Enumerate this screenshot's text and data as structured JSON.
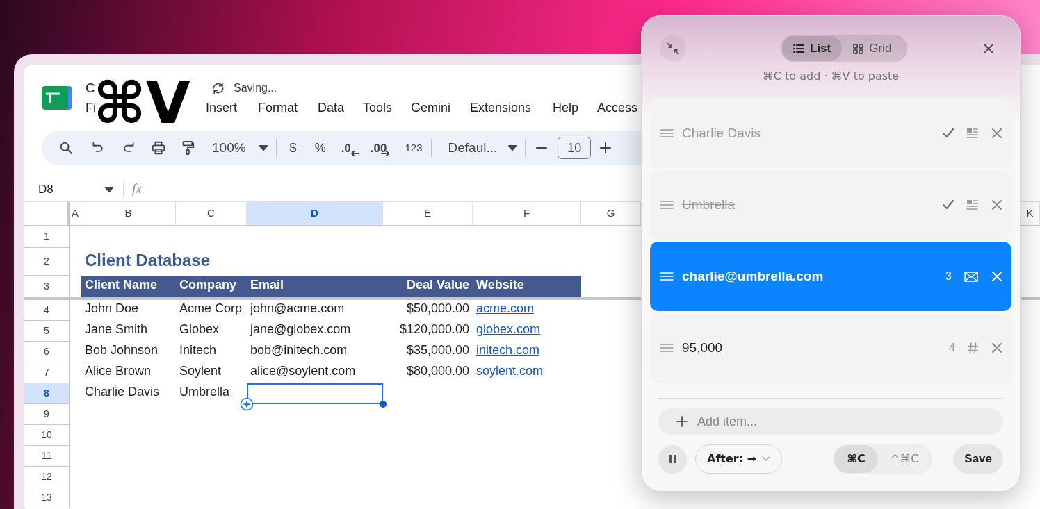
{
  "sheet": {
    "title": "C",
    "save_status": "Saving...",
    "menu": [
      "Fi",
      "Insert",
      "Format",
      "Data",
      "Tools",
      "Gemini",
      "Extensions",
      "Help",
      "Access"
    ],
    "toolbar": {
      "zoom": "100%",
      "currency": "$",
      "percent": "%",
      "decrease_decimals": ".0",
      "increase_decimals": ".00",
      "number_format": "123",
      "font": "Defaul...",
      "font_size": "10"
    },
    "name_box": "D8",
    "formula_label": "fx",
    "columns": [
      {
        "label": "A",
        "selected": false
      },
      {
        "label": "B",
        "selected": false
      },
      {
        "label": "C",
        "selected": false
      },
      {
        "label": "D",
        "selected": true
      },
      {
        "label": "E",
        "selected": false
      },
      {
        "label": "F",
        "selected": false
      },
      {
        "label": "G",
        "selected": false
      },
      {
        "label": "K",
        "selected": false
      }
    ],
    "rows": [
      {
        "label": "1",
        "selected": false
      },
      {
        "label": "2",
        "selected": false
      },
      {
        "label": "3",
        "selected": false
      },
      {
        "label": "4",
        "selected": false
      },
      {
        "label": "5",
        "selected": false
      },
      {
        "label": "6",
        "selected": false
      },
      {
        "label": "7",
        "selected": false
      },
      {
        "label": "8",
        "selected": true
      },
      {
        "label": "9",
        "selected": false
      },
      {
        "label": "10",
        "selected": false
      },
      {
        "label": "11",
        "selected": false
      },
      {
        "label": "12",
        "selected": false
      },
      {
        "label": "13",
        "selected": false
      }
    ],
    "table_title": "Client Database",
    "table_header": [
      "Client Name",
      "Company",
      "Email",
      "Deal Value",
      "Website"
    ],
    "records": [
      {
        "client_name": "John Doe",
        "company": "Acme Corp",
        "email": "john@acme.com",
        "deal_value": "$50,000.00",
        "website": "acme.com"
      },
      {
        "client_name": "Jane Smith",
        "company": "Globex",
        "email": "jane@globex.com",
        "deal_value": "$120,000.00",
        "website": "globex.com"
      },
      {
        "client_name": "Bob Johnson",
        "company": "Initech",
        "email": "bob@initech.com",
        "deal_value": "$35,000.00",
        "website": "initech.com"
      },
      {
        "client_name": "Alice Brown",
        "company": "Soylent",
        "email": "alice@soylent.com",
        "deal_value": "$80,000.00",
        "website": "soylent.com"
      },
      {
        "client_name": "Charlie Davis",
        "company": "Umbrella"
      }
    ]
  },
  "shortcut_overlay": "⌘V",
  "clipboard_panel": {
    "views": [
      {
        "label": "List",
        "kind": "list",
        "selected": true
      },
      {
        "label": "Grid",
        "kind": "grid",
        "selected": false
      }
    ],
    "hint": "⌘C to add · ⌘V to paste",
    "items": [
      {
        "text": "Charlie Davis",
        "kind": "text",
        "done": true,
        "selected": false
      },
      {
        "text": "Umbrella",
        "kind": "text",
        "done": true,
        "selected": false
      },
      {
        "text": "charlie@umbrella.com",
        "kind": "email",
        "done": false,
        "selected": true,
        "number": "3"
      },
      {
        "text": "95,000",
        "kind": "number",
        "done": false,
        "selected": false,
        "number": "4"
      }
    ],
    "add_placeholder": "Add item...",
    "insert_mode": "After: →",
    "copy_modes": [
      {
        "label": "⌘C",
        "selected": true
      },
      {
        "label": "^⌘C",
        "selected": false
      }
    ],
    "save_label": "Save"
  }
}
